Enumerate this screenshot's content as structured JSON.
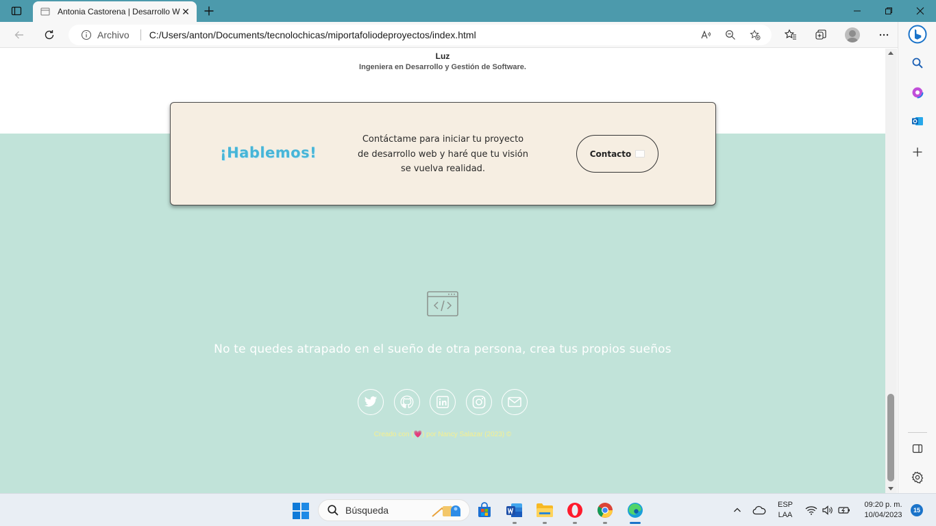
{
  "browser": {
    "tab": {
      "title": "Antonia Castorena | Desarrollo Web"
    },
    "address": {
      "scheme_label": "Archivo",
      "url": "C:/Users/anton/Documents/tecnolochicas/miportafoliodeproyectos/index.html"
    }
  },
  "page": {
    "profile": {
      "name": "Luz",
      "role": "Ingeniera en Desarrollo y Gestión de Software."
    },
    "contact_card": {
      "heading": "¡Hablemos!",
      "text": "Contáctame para iniciar tu proyecto de desarrollo web y haré que tu visión se vuelva realidad.",
      "button_label": "Contacto"
    },
    "footer": {
      "quote": "No te quedes atrapado en el sueño de otra persona, crea tus propios sueños",
      "socials": [
        "twitter-icon",
        "github-icon",
        "linkedin-icon",
        "instagram-icon",
        "mail-icon"
      ],
      "credit_prefix": "Creado con (",
      "credit_heart": "💗",
      "credit_suffix": ") por Nancy Salazar (2023) ©"
    },
    "colors": {
      "footer_bg": "#c1e3d9",
      "card_bg": "#f6eee2",
      "heading_color": "#47b5d7",
      "credit_color": "#f7f08e"
    }
  },
  "taskbar": {
    "search_placeholder": "Búsqueda",
    "language": {
      "line1": "ESP",
      "line2": "LAA"
    },
    "clock": {
      "time": "09:20 p. m.",
      "date": "10/04/2023"
    },
    "notifications": "15"
  }
}
